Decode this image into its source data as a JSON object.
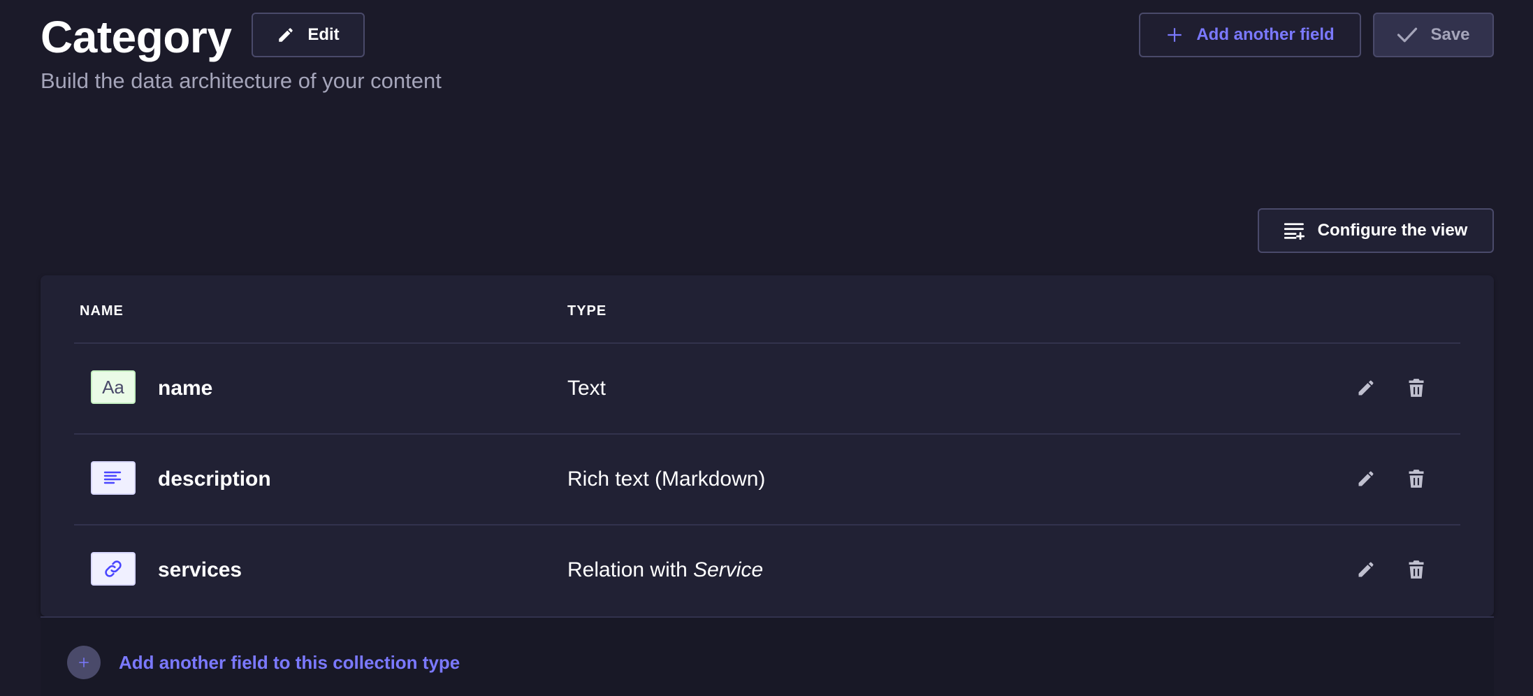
{
  "header": {
    "title": "Category",
    "subtitle": "Build the data architecture of your content",
    "edit_label": "Edit",
    "add_field_label": "Add another field",
    "save_label": "Save"
  },
  "toolbar": {
    "configure_label": "Configure the view"
  },
  "table": {
    "columns": [
      "NAME",
      "TYPE"
    ],
    "rows": [
      {
        "name": "name",
        "type": "Text",
        "icon": "text-icon"
      },
      {
        "name": "description",
        "type": "Rich text (Markdown)",
        "icon": "rich-text-icon"
      },
      {
        "name": "services",
        "type_prefix": "Relation with ",
        "type_target": "Service",
        "icon": "relation-icon"
      }
    ]
  },
  "footer": {
    "add_field_label": "Add another field to this collection type"
  },
  "colors": {
    "background": "#1b1a29",
    "card": "#212134",
    "accent": "#7b79ff",
    "muted": "#a5a5ba",
    "border": "#4a4a6a"
  }
}
